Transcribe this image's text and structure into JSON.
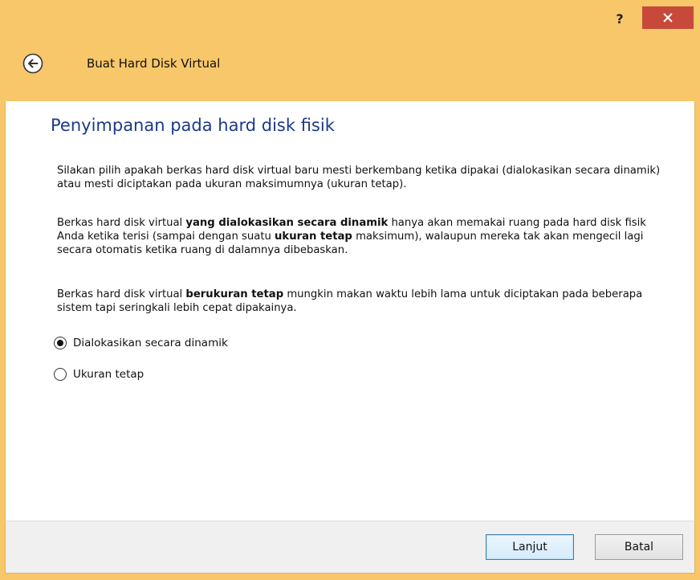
{
  "titlebar": {
    "help_label": "?",
    "close_icon": "close-icon"
  },
  "nav": {
    "back_icon": "back-arrow-icon",
    "wizard_title": "Buat Hard Disk Virtual"
  },
  "page": {
    "heading": "Penyimpanan pada hard disk fisik",
    "para1": "Silakan pilih apakah berkas hard disk virtual baru mesti berkembang ketika dipakai (dialokasikan secara dinamik) atau mesti diciptakan pada ukuran maksimumnya (ukuran tetap).",
    "para2": {
      "t1": "Berkas hard disk virtual ",
      "b1": "yang dialokasikan secara dinamik",
      "t2": " hanya akan memakai ruang pada hard disk fisik Anda ketika terisi (sampai dengan suatu ",
      "b2": "ukuran tetap",
      "t3": " maksimum), walaupun mereka tak akan mengecil lagi secara otomatis ketika ruang di dalamnya dibebaskan."
    },
    "para3": {
      "t1": "Berkas hard disk virtual ",
      "b1": "berukuran tetap",
      "t2": " mungkin makan waktu lebih lama untuk diciptakan pada beberapa sistem tapi seringkali lebih cepat dipakainya."
    },
    "options": [
      {
        "label": "Dialokasikan secara dinamik",
        "selected": true
      },
      {
        "label": "Ukuran tetap",
        "selected": false
      }
    ]
  },
  "footer": {
    "next_label": "Lanjut",
    "cancel_label": "Batal"
  },
  "colors": {
    "window_frame": "#f8c76a",
    "close_button": "#c7493a",
    "heading": "#1a3a8a"
  }
}
